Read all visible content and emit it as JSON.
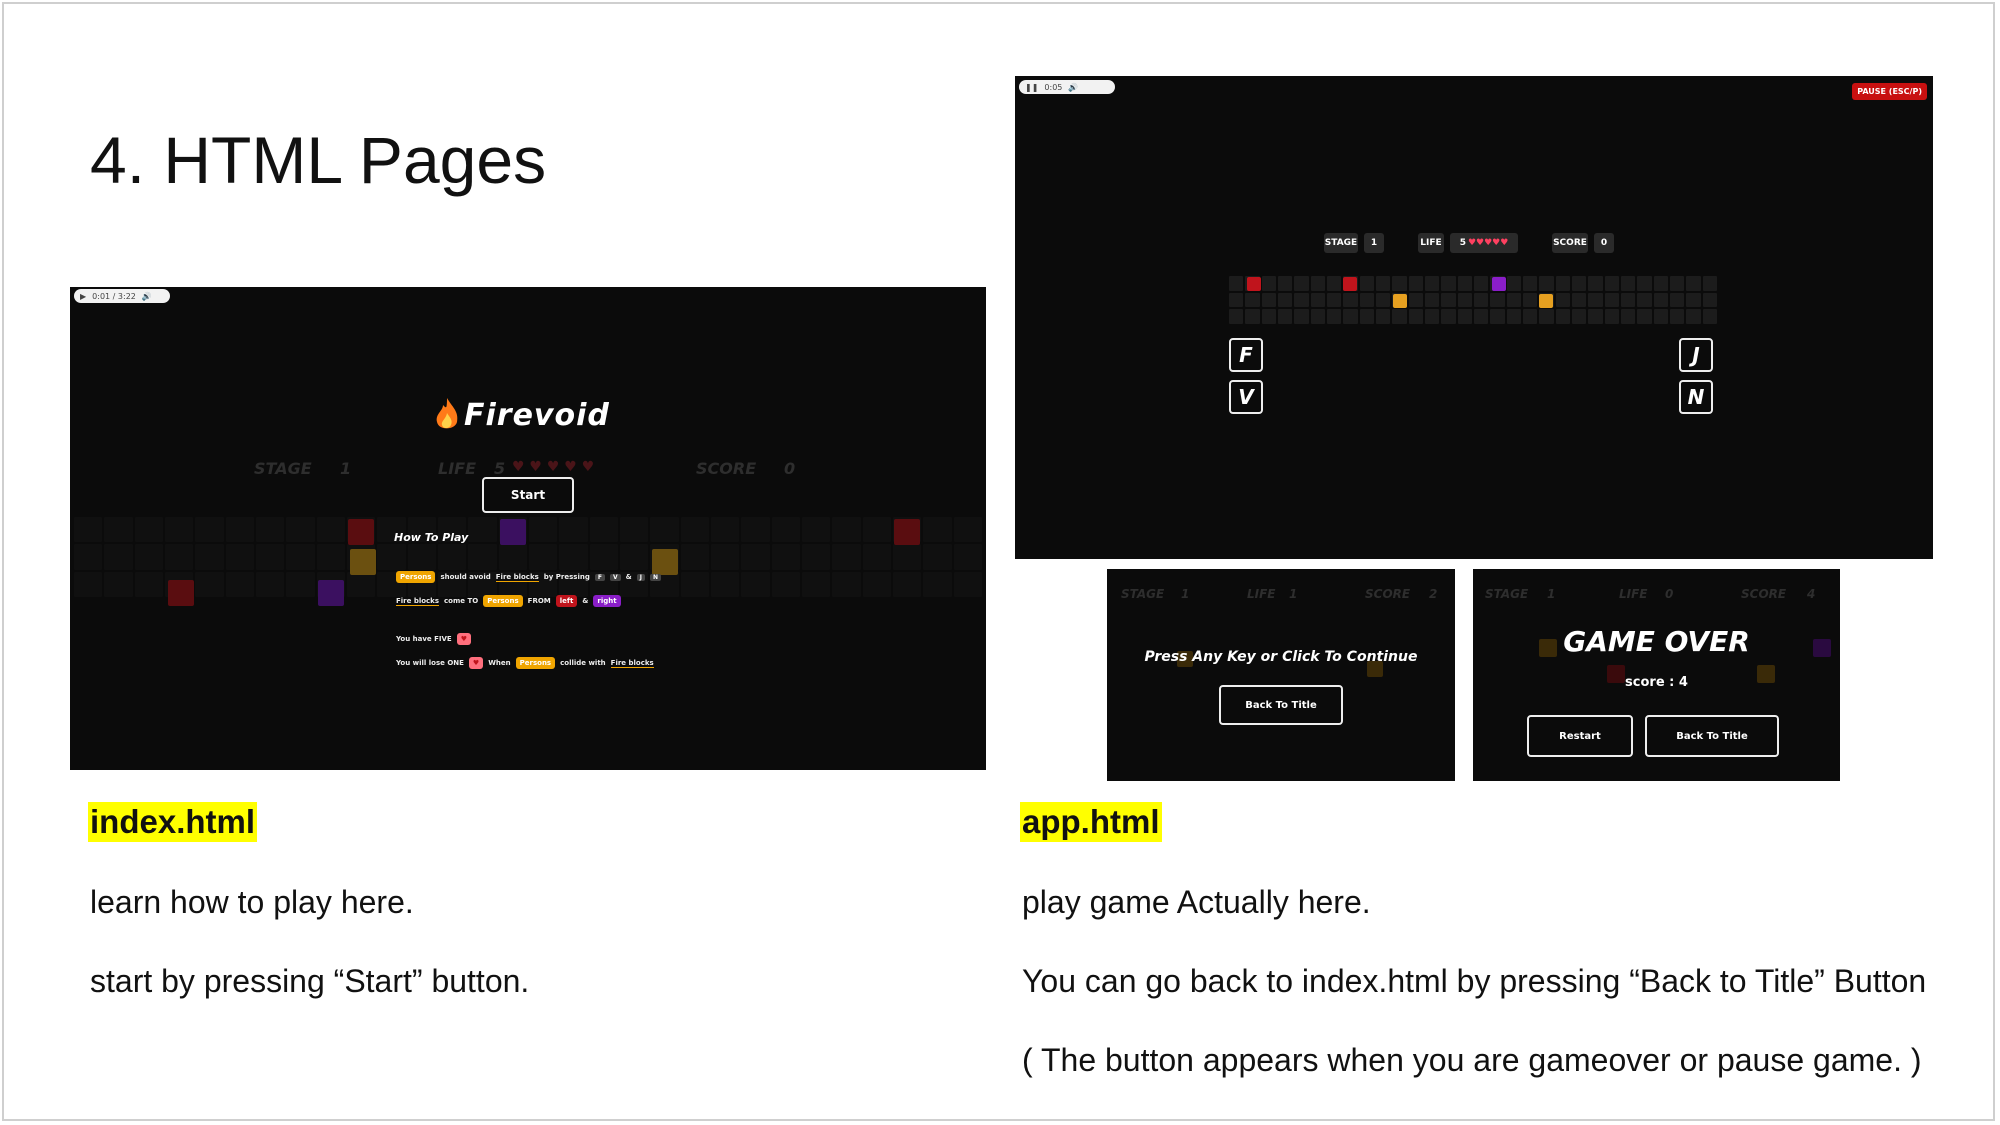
{
  "slide_title": "4. HTML Pages",
  "left": {
    "media_time": "0:01 / 3:22",
    "game_title": "Firevoid",
    "hud": {
      "stage_label": "STAGE",
      "stage_value": "1",
      "life_label": "LIFE",
      "life_value": "5",
      "score_label": "SCORE",
      "score_value": "0"
    },
    "start_button": "Start",
    "how_to_play": {
      "heading": "How To Play",
      "persons": "Persons",
      "should_avoid": "should avoid",
      "fire_blocks": "Fire blocks",
      "by_pressing": "by Pressing",
      "keys": [
        "F",
        "V",
        "J",
        "N"
      ],
      "come_to": "come TO",
      "from": "FROM",
      "left": "left",
      "and": "&",
      "right": "right",
      "you_have": "You have FIVE",
      "you_will_lose": "You will lose ONE",
      "when": "When",
      "collide_with": "collide with"
    },
    "file_label": "index.html",
    "desc1": "learn how to play here.",
    "desc2": "start by pressing “Start” button."
  },
  "right": {
    "media_time": "0:05",
    "pause_button": "PAUSE (ESC/P)",
    "hud": {
      "stage_label": "STAGE",
      "stage_value": "1",
      "life_label": "LIFE",
      "life_value": "5",
      "score_label": "SCORE",
      "score_value": "0"
    },
    "keys": {
      "f": "F",
      "v": "V",
      "j": "J",
      "n": "N"
    },
    "pause_screen": {
      "hud": {
        "stage_label": "STAGE",
        "stage_value": "1",
        "life_label": "LIFE",
        "life_value": "1",
        "score_label": "SCORE",
        "score_value": "2"
      },
      "message": "Press Any Key or Click To Continue",
      "back_button": "Back To Title"
    },
    "gameover_screen": {
      "hud": {
        "stage_label": "STAGE",
        "stage_value": "1",
        "life_label": "LIFE",
        "life_value": "0",
        "score_label": "SCORE",
        "score_value": "4"
      },
      "title": "GAME OVER",
      "score": "score : 4",
      "restart_button": "Restart",
      "back_button": "Back To Title"
    },
    "file_label": "app.html",
    "desc1": "play game Actually here.",
    "desc2": "You can go back to index.html by pressing “Back to Title” Button",
    "desc3": "( The button appears when you are gameover or pause game. )"
  },
  "colors": {
    "red": "#c0141c",
    "yellow": "#f0a500",
    "purple": "#8a1ec8",
    "pause_red": "#c81010"
  }
}
